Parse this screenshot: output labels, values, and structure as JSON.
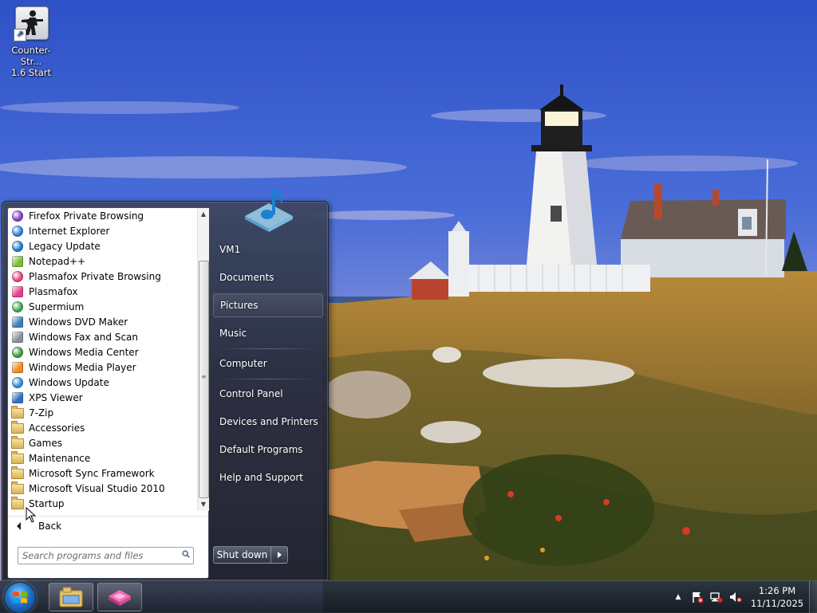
{
  "desktop": {
    "icons": [
      {
        "label_line1": "Counter-Str...",
        "label_line2": "1.6 Start",
        "icon": "counter-strike-icon"
      }
    ]
  },
  "start_menu": {
    "programs": [
      {
        "label": "Firefox Private Browsing",
        "icon": "firefox-private-icon",
        "color": "#7b3fc9"
      },
      {
        "label": "Internet Explorer",
        "icon": "internet-explorer-icon",
        "color": "#2b7fd4"
      },
      {
        "label": "Legacy Update",
        "icon": "legacy-update-icon",
        "color": "#1c7ad1"
      },
      {
        "label": "Notepad++",
        "icon": "notepad-plus-plus-icon",
        "color": "#7dbd3a"
      },
      {
        "label": "Plasmafox Private Browsing",
        "icon": "plasmafox-private-icon",
        "color": "#e0457b"
      },
      {
        "label": "Plasmafox",
        "icon": "plasmafox-icon",
        "color": "#e43c8c"
      },
      {
        "label": "Supermium",
        "icon": "supermium-icon",
        "color": "#3fa34d"
      },
      {
        "label": "Windows DVD Maker",
        "icon": "dvd-maker-icon",
        "color": "#3c7fb8"
      },
      {
        "label": "Windows Fax and Scan",
        "icon": "fax-scan-icon",
        "color": "#8a8f99"
      },
      {
        "label": "Windows Media Center",
        "icon": "media-center-icon",
        "color": "#3a9a3c"
      },
      {
        "label": "Windows Media Player",
        "icon": "media-player-icon",
        "color": "#f08a1c"
      },
      {
        "label": "Windows Update",
        "icon": "windows-update-icon",
        "color": "#2a8ad6"
      },
      {
        "label": "XPS Viewer",
        "icon": "xps-viewer-icon",
        "color": "#2f6fc4"
      },
      {
        "label": "7-Zip",
        "icon": "folder-icon",
        "color": "#d9b25a"
      },
      {
        "label": "Accessories",
        "icon": "folder-icon",
        "color": "#d9b25a"
      },
      {
        "label": "Games",
        "icon": "folder-icon",
        "color": "#d9b25a"
      },
      {
        "label": "Maintenance",
        "icon": "folder-icon",
        "color": "#d9b25a"
      },
      {
        "label": "Microsoft Sync Framework",
        "icon": "folder-icon",
        "color": "#d9b25a"
      },
      {
        "label": "Microsoft Visual Studio 2010",
        "icon": "folder-icon",
        "color": "#d9b25a"
      },
      {
        "label": "Startup",
        "icon": "folder-icon",
        "color": "#d9b25a"
      }
    ],
    "back_label": "Back",
    "search_placeholder": "Search programs and files",
    "right_links": [
      {
        "label": "VM1",
        "hover": false
      },
      {
        "label": "Documents",
        "hover": false
      },
      {
        "label": "Pictures",
        "hover": true
      },
      {
        "label": "Music",
        "hover": false
      },
      {
        "label": "Computer",
        "hover": false
      },
      {
        "label": "Control Panel",
        "hover": false
      },
      {
        "label": "Devices and Printers",
        "hover": false
      },
      {
        "label": "Default Programs",
        "hover": false
      },
      {
        "label": "Help and Support",
        "hover": false
      }
    ],
    "shutdown_label": "Shut down"
  },
  "taskbar": {
    "pinned": [
      {
        "name": "file-explorer",
        "icon": "folder-library-icon"
      },
      {
        "name": "plasmafox",
        "icon": "plasmafox-icon"
      }
    ],
    "clock_time": "1:26 PM",
    "clock_date": "11/11/2025"
  },
  "colors": {
    "accent": "#1f72c7",
    "taskbar": "#1c2533",
    "menu_dark": "#2a2e3c"
  }
}
